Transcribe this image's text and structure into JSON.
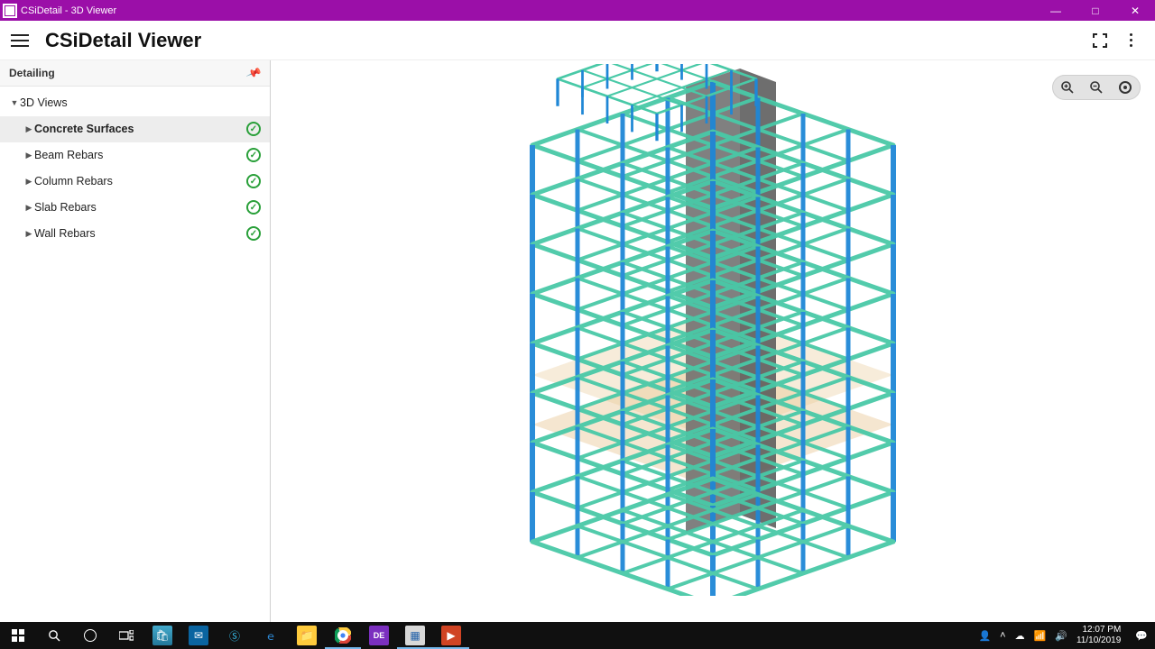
{
  "window": {
    "title": "CSiDetail - 3D Viewer"
  },
  "header": {
    "app_title": "CSiDetail Viewer"
  },
  "sidebar": {
    "panel_title": "Detailing",
    "root_label": "3D Views",
    "items": [
      {
        "label": "Concrete Surfaces",
        "selected": true
      },
      {
        "label": "Beam Rebars",
        "selected": false
      },
      {
        "label": "Column Rebars",
        "selected": false
      },
      {
        "label": "Slab Rebars",
        "selected": false
      },
      {
        "label": "Wall Rebars",
        "selected": false
      }
    ]
  },
  "viewer": {
    "colors": {
      "beam": "#49c9a7",
      "column": "#1f87d6",
      "core": "#6a6a6a",
      "slab": "#e9c896"
    }
  },
  "taskbar": {
    "time": "12:07 PM",
    "date": "11/10/2019"
  }
}
